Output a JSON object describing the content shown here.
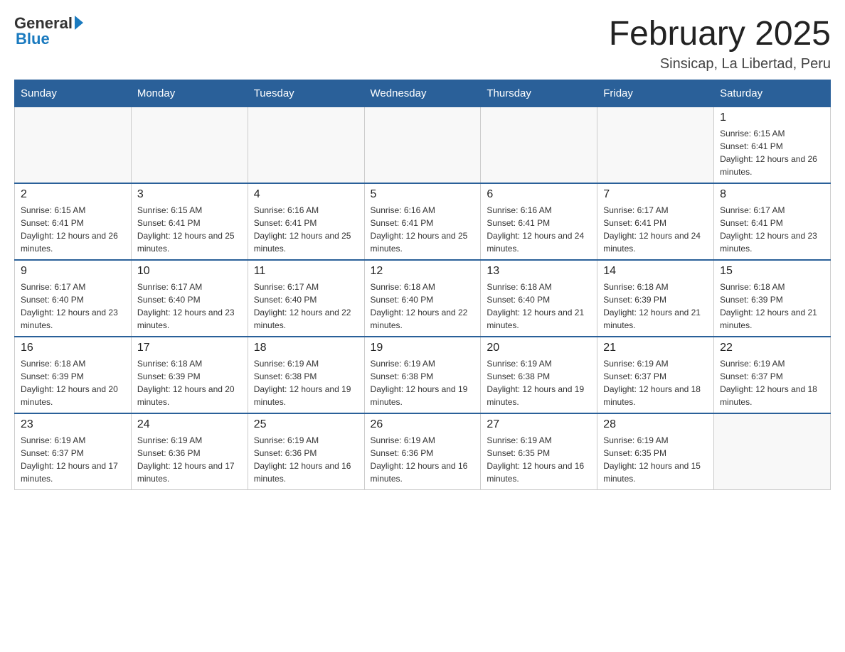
{
  "header": {
    "logo": {
      "general": "General",
      "blue": "Blue"
    },
    "title": "February 2025",
    "location": "Sinsicap, La Libertad, Peru"
  },
  "days_of_week": [
    "Sunday",
    "Monday",
    "Tuesday",
    "Wednesday",
    "Thursday",
    "Friday",
    "Saturday"
  ],
  "weeks": [
    {
      "days": [
        {
          "num": "",
          "info": ""
        },
        {
          "num": "",
          "info": ""
        },
        {
          "num": "",
          "info": ""
        },
        {
          "num": "",
          "info": ""
        },
        {
          "num": "",
          "info": ""
        },
        {
          "num": "",
          "info": ""
        },
        {
          "num": "1",
          "info": "Sunrise: 6:15 AM\nSunset: 6:41 PM\nDaylight: 12 hours and 26 minutes."
        }
      ]
    },
    {
      "days": [
        {
          "num": "2",
          "info": "Sunrise: 6:15 AM\nSunset: 6:41 PM\nDaylight: 12 hours and 26 minutes."
        },
        {
          "num": "3",
          "info": "Sunrise: 6:15 AM\nSunset: 6:41 PM\nDaylight: 12 hours and 25 minutes."
        },
        {
          "num": "4",
          "info": "Sunrise: 6:16 AM\nSunset: 6:41 PM\nDaylight: 12 hours and 25 minutes."
        },
        {
          "num": "5",
          "info": "Sunrise: 6:16 AM\nSunset: 6:41 PM\nDaylight: 12 hours and 25 minutes."
        },
        {
          "num": "6",
          "info": "Sunrise: 6:16 AM\nSunset: 6:41 PM\nDaylight: 12 hours and 24 minutes."
        },
        {
          "num": "7",
          "info": "Sunrise: 6:17 AM\nSunset: 6:41 PM\nDaylight: 12 hours and 24 minutes."
        },
        {
          "num": "8",
          "info": "Sunrise: 6:17 AM\nSunset: 6:41 PM\nDaylight: 12 hours and 23 minutes."
        }
      ]
    },
    {
      "days": [
        {
          "num": "9",
          "info": "Sunrise: 6:17 AM\nSunset: 6:40 PM\nDaylight: 12 hours and 23 minutes."
        },
        {
          "num": "10",
          "info": "Sunrise: 6:17 AM\nSunset: 6:40 PM\nDaylight: 12 hours and 23 minutes."
        },
        {
          "num": "11",
          "info": "Sunrise: 6:17 AM\nSunset: 6:40 PM\nDaylight: 12 hours and 22 minutes."
        },
        {
          "num": "12",
          "info": "Sunrise: 6:18 AM\nSunset: 6:40 PM\nDaylight: 12 hours and 22 minutes."
        },
        {
          "num": "13",
          "info": "Sunrise: 6:18 AM\nSunset: 6:40 PM\nDaylight: 12 hours and 21 minutes."
        },
        {
          "num": "14",
          "info": "Sunrise: 6:18 AM\nSunset: 6:39 PM\nDaylight: 12 hours and 21 minutes."
        },
        {
          "num": "15",
          "info": "Sunrise: 6:18 AM\nSunset: 6:39 PM\nDaylight: 12 hours and 21 minutes."
        }
      ]
    },
    {
      "days": [
        {
          "num": "16",
          "info": "Sunrise: 6:18 AM\nSunset: 6:39 PM\nDaylight: 12 hours and 20 minutes."
        },
        {
          "num": "17",
          "info": "Sunrise: 6:18 AM\nSunset: 6:39 PM\nDaylight: 12 hours and 20 minutes."
        },
        {
          "num": "18",
          "info": "Sunrise: 6:19 AM\nSunset: 6:38 PM\nDaylight: 12 hours and 19 minutes."
        },
        {
          "num": "19",
          "info": "Sunrise: 6:19 AM\nSunset: 6:38 PM\nDaylight: 12 hours and 19 minutes."
        },
        {
          "num": "20",
          "info": "Sunrise: 6:19 AM\nSunset: 6:38 PM\nDaylight: 12 hours and 19 minutes."
        },
        {
          "num": "21",
          "info": "Sunrise: 6:19 AM\nSunset: 6:37 PM\nDaylight: 12 hours and 18 minutes."
        },
        {
          "num": "22",
          "info": "Sunrise: 6:19 AM\nSunset: 6:37 PM\nDaylight: 12 hours and 18 minutes."
        }
      ]
    },
    {
      "days": [
        {
          "num": "23",
          "info": "Sunrise: 6:19 AM\nSunset: 6:37 PM\nDaylight: 12 hours and 17 minutes."
        },
        {
          "num": "24",
          "info": "Sunrise: 6:19 AM\nSunset: 6:36 PM\nDaylight: 12 hours and 17 minutes."
        },
        {
          "num": "25",
          "info": "Sunrise: 6:19 AM\nSunset: 6:36 PM\nDaylight: 12 hours and 16 minutes."
        },
        {
          "num": "26",
          "info": "Sunrise: 6:19 AM\nSunset: 6:36 PM\nDaylight: 12 hours and 16 minutes."
        },
        {
          "num": "27",
          "info": "Sunrise: 6:19 AM\nSunset: 6:35 PM\nDaylight: 12 hours and 16 minutes."
        },
        {
          "num": "28",
          "info": "Sunrise: 6:19 AM\nSunset: 6:35 PM\nDaylight: 12 hours and 15 minutes."
        },
        {
          "num": "",
          "info": ""
        }
      ]
    }
  ]
}
